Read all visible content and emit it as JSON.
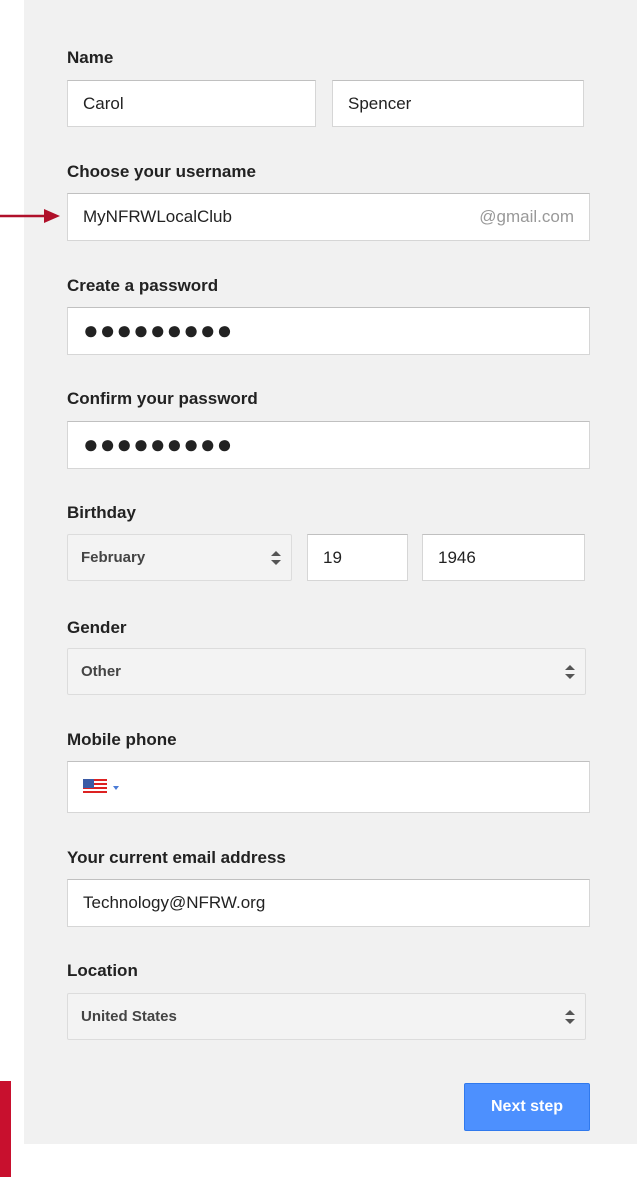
{
  "form": {
    "name": {
      "label": "Name",
      "first_value": "Carol",
      "last_value": "Spencer"
    },
    "username": {
      "label": "Choose your username",
      "value": "MyNFRWLocalClub",
      "suffix": "@gmail.com"
    },
    "password": {
      "label": "Create a password",
      "masked": "●●●●●●●●●"
    },
    "confirm_password": {
      "label": "Confirm your password",
      "masked": "●●●●●●●●●"
    },
    "birthday": {
      "label": "Birthday",
      "month": "February",
      "day": "19",
      "year": "1946"
    },
    "gender": {
      "label": "Gender",
      "value": "Other"
    },
    "mobile_phone": {
      "label": "Mobile phone",
      "country_flag_icon": "us-flag-icon"
    },
    "current_email": {
      "label": "Your current email address",
      "value": "Technology@NFRW.org"
    },
    "location": {
      "label": "Location",
      "value": "United States"
    },
    "next_button": "Next step"
  },
  "colors": {
    "panel_bg": "#f1f1f1",
    "button_blue": "#4d90fe",
    "arrow_red": "#b0102a",
    "accent_red": "#c8102e"
  }
}
